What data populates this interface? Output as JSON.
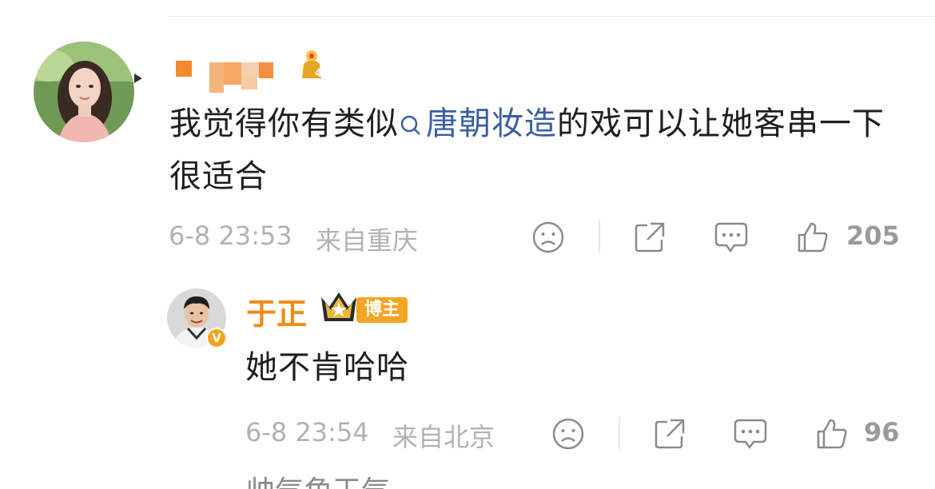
{
  "comment": {
    "text_before": "我觉得你有类似",
    "topic": "唐朝妆造",
    "text_after": "的戏可以让她客串一下很适合",
    "time": "6-8 23:53",
    "location": "来自重庆",
    "likes": "205",
    "icons": [
      "sad-emoji-icon",
      "share-icon",
      "comment-icon",
      "thumbs-up-icon"
    ]
  },
  "reply": {
    "author": "于正",
    "role_badge": "博主",
    "verified": "V",
    "text": "她不肯哈哈",
    "time": "6-8 23:54",
    "location": "来自北京",
    "likes": "96"
  },
  "next_snippet": "帅气角王气"
}
